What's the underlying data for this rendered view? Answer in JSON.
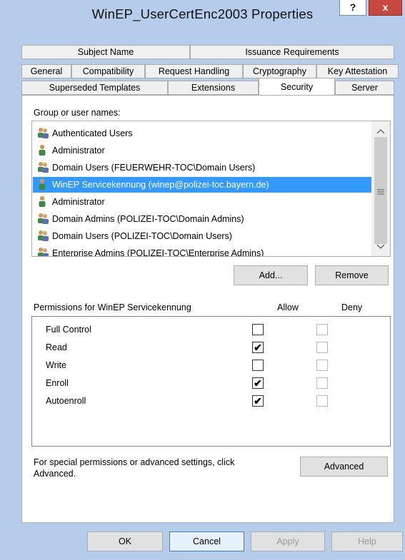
{
  "window": {
    "title": "WinEP_UserCertEnc2003 Properties",
    "help_label": "?",
    "close_label": "x"
  },
  "tabs": {
    "row1": [
      "Subject Name",
      "Issuance Requirements"
    ],
    "row2": [
      "General",
      "Compatibility",
      "Request Handling",
      "Cryptography",
      "Key Attestation"
    ],
    "row3": [
      "Superseded Templates",
      "Extensions",
      "Security",
      "Server"
    ],
    "active": "Security"
  },
  "security": {
    "group_label": "Group or user names:",
    "users": [
      {
        "name": "Authenticated Users",
        "icon": "group-icon"
      },
      {
        "name": "Administrator",
        "icon": "user-icon"
      },
      {
        "name": "Domain Users (FEUERWEHR-TOC\\Domain Users)",
        "icon": "group-icon"
      },
      {
        "name": "WinEP Servicekennung (winep@polizei-toc.bayern.de)",
        "icon": "user-icon",
        "selected": true
      },
      {
        "name": "Administrator",
        "icon": "user-icon"
      },
      {
        "name": "Domain Admins (POLIZEI-TOC\\Domain Admins)",
        "icon": "group-icon"
      },
      {
        "name": "Domain Users (POLIZEI-TOC\\Domain Users)",
        "icon": "group-icon"
      },
      {
        "name": "Enterprise Admins (POLIZEI-TOC\\Enterprise Admins)",
        "icon": "group-icon"
      }
    ],
    "add_label": "Add...",
    "remove_label": "Remove",
    "perm_label": "Permissions for WinEP Servicekennung",
    "allow_label": "Allow",
    "deny_label": "Deny",
    "permissions": [
      {
        "name": "Full Control",
        "allow": false,
        "deny": false
      },
      {
        "name": "Read",
        "allow": true,
        "deny": false
      },
      {
        "name": "Write",
        "allow": false,
        "deny": false
      },
      {
        "name": "Enroll",
        "allow": true,
        "deny": false
      },
      {
        "name": "Autoenroll",
        "allow": true,
        "deny": false
      }
    ],
    "advanced_text": "For special permissions or advanced settings, click Advanced.",
    "advanced_label": "Advanced"
  },
  "footer": {
    "ok": "OK",
    "cancel": "Cancel",
    "apply": "Apply",
    "help": "Help"
  },
  "colors": {
    "selection": "#3399ff",
    "title_bar": "#b5cdea",
    "close": "#c6483f"
  }
}
